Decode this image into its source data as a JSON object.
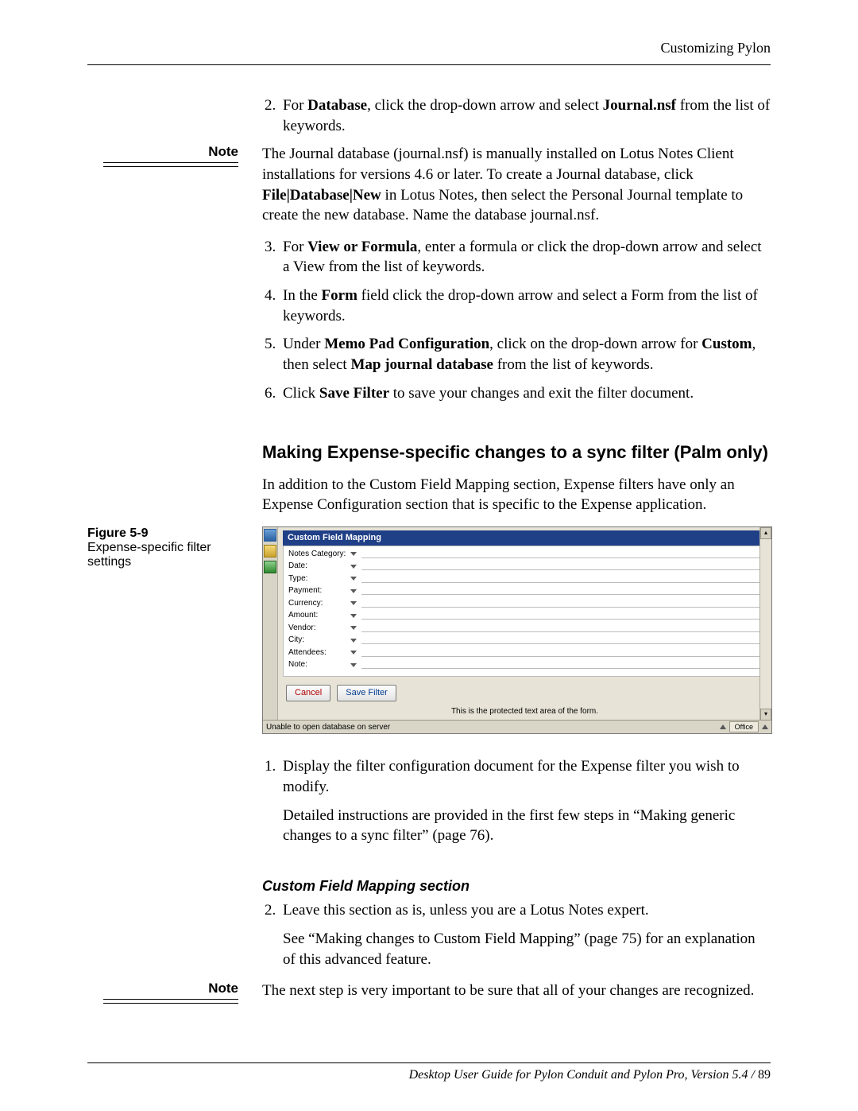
{
  "header": {
    "running": "Customizing Pylon"
  },
  "margin": {
    "note": "Note"
  },
  "steps": {
    "s2": {
      "pre": "For ",
      "b1": "Database",
      "mid": ", click the drop-down arrow and select ",
      "b2": "Journal.nsf",
      "post": " from the list of keywords."
    },
    "note1": {
      "t1": "The Journal database (journal.nsf) is manually installed on Lotus Notes Client installations for versions 4.6 or later. To create a Journal database, click ",
      "b": "File|Database|New",
      "t2": " in Lotus Notes, then select the Personal Journal template to create the new database. Name the database journal.nsf."
    },
    "s3": {
      "pre": "For ",
      "b": "View or Formula",
      "post": ", enter a formula or click the drop-down arrow and select a View from the list of keywords."
    },
    "s4": {
      "pre": "In the ",
      "b": "Form",
      "post": " field click the drop-down arrow and select a Form from the list of keywords."
    },
    "s5": {
      "pre": "Under ",
      "b1": "Memo Pad Configuration",
      "mid": ", click on the drop-down arrow for ",
      "b2": "Custom",
      "mid2": ", then select ",
      "b3": "Map journal database",
      "post": " from the list of keywords."
    },
    "s6": {
      "pre": "Click ",
      "b": "Save Filter",
      "post": " to save your changes and exit the filter document."
    }
  },
  "section": {
    "title": "Making Expense-specific changes to a sync filter (Palm only)",
    "intro": "In addition to the Custom Field Mapping section, Expense filters have only an Expense Configuration section that is specific to the Expense application."
  },
  "figure": {
    "num": "Figure 5-9",
    "caption": "Expense-specific filter settings",
    "cfm_title": "Custom Field Mapping",
    "rows": [
      "Notes Category:",
      "Date:",
      "Type:",
      "Payment:",
      "Currency:",
      "Amount:",
      "Vendor:",
      "City:",
      "Attendees:",
      "Note:"
    ],
    "cancel": "Cancel",
    "save": "Save Filter",
    "protected": "This is the protected text area of the form.",
    "status_left": "Unable to open database  on server",
    "status_office": "Office"
  },
  "lower": {
    "s1": "Display the filter configuration document for the Expense filter you wish to modify.",
    "s1b": "Detailed instructions are provided in the first few steps in “Making generic changes to a sync filter” (page 76).",
    "subhead": "Custom Field Mapping section",
    "s2": "Leave this section as is, unless you are a Lotus Notes expert.",
    "s2b": "See “Making changes to Custom Field Mapping” (page 75) for an explanation of this advanced feature.",
    "note2": "The next step is very important to be sure that all of your changes are recognized."
  },
  "footer": {
    "text": "Desktop User Guide for Pylon Conduit and Pylon Pro, Version 5.4  /  ",
    "page": "89"
  }
}
